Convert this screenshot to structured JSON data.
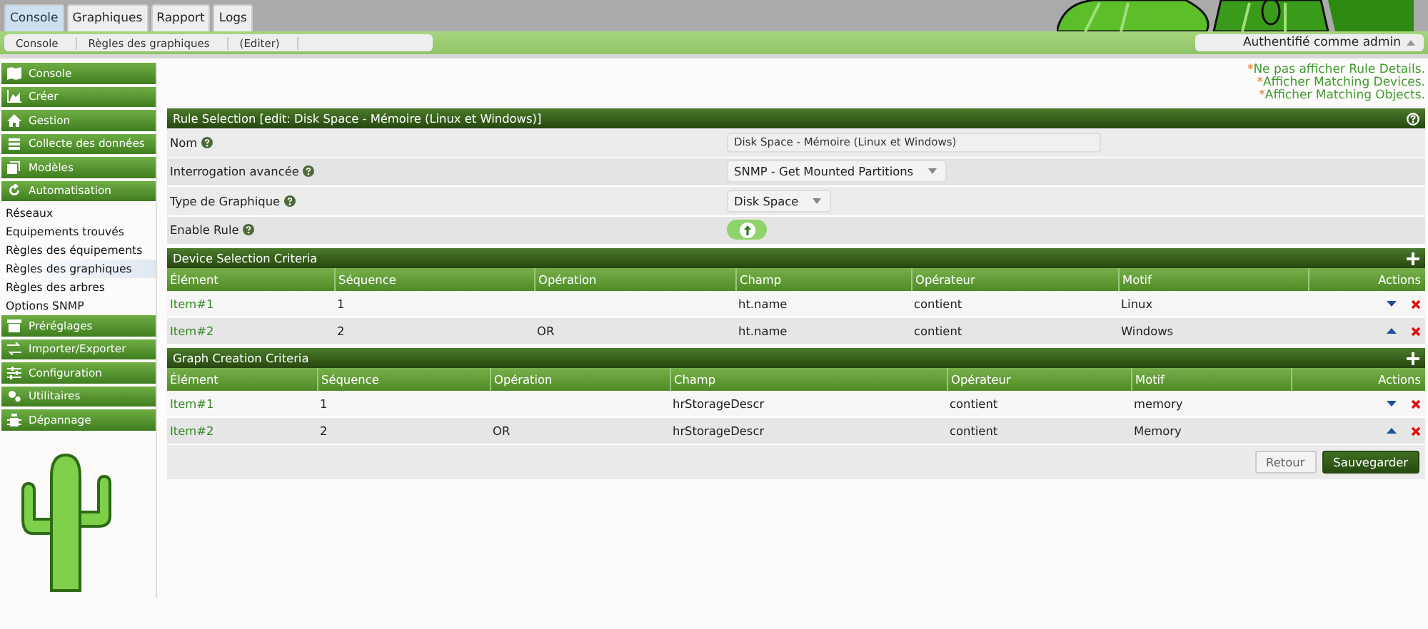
{
  "tabs": [
    {
      "label": "Console",
      "selected": true
    },
    {
      "label": "Graphiques",
      "selected": false
    },
    {
      "label": "Rapport",
      "selected": false
    },
    {
      "label": "Logs",
      "selected": false
    }
  ],
  "breadcrumb": [
    "Console",
    "Règles des graphiques",
    "(Editer)"
  ],
  "user_menu": {
    "label": "Authentifié comme admin"
  },
  "sidebar": {
    "items": [
      {
        "kind": "header",
        "label": "Console",
        "selected": false
      },
      {
        "kind": "header",
        "label": "Créer",
        "selected": false
      },
      {
        "kind": "header",
        "label": "Gestion",
        "selected": false
      },
      {
        "kind": "header",
        "label": "Collecte des données",
        "selected": false
      },
      {
        "kind": "header",
        "label": "Modèles",
        "selected": false
      },
      {
        "kind": "header",
        "label": "Automatisation",
        "selected": false
      },
      {
        "kind": "link",
        "label": "Réseaux",
        "selected": false
      },
      {
        "kind": "link",
        "label": "Equipements trouvés",
        "selected": false
      },
      {
        "kind": "link",
        "label": "Règles des équipements",
        "selected": false
      },
      {
        "kind": "link",
        "label": "Règles des graphiques",
        "selected": true
      },
      {
        "kind": "link",
        "label": "Règles des arbres",
        "selected": false
      },
      {
        "kind": "link",
        "label": "Options SNMP",
        "selected": false
      },
      {
        "kind": "header",
        "label": "Préréglages",
        "selected": false
      },
      {
        "kind": "header",
        "label": "Importer/Exporter",
        "selected": false
      },
      {
        "kind": "header",
        "label": "Configuration",
        "selected": false
      },
      {
        "kind": "header",
        "label": "Utilitaires",
        "selected": false
      },
      {
        "kind": "header",
        "label": "Dépannage",
        "selected": false
      }
    ]
  },
  "links": [
    {
      "marker": "*",
      "text": "Ne pas afficher Rule Details."
    },
    {
      "marker": "*",
      "text": "Afficher Matching Devices."
    },
    {
      "marker": "*",
      "text": "Afficher Matching Objects."
    }
  ],
  "rule_form": {
    "title": "Rule Selection [edit: Disk Space - Mémoire (Linux et Windows)]",
    "fields": [
      {
        "kind": "text",
        "label": "Nom",
        "value": "Disk Space - Mémoire (Linux et Windows)"
      },
      {
        "kind": "select",
        "label": "Interrogation avancée",
        "value": "SNMP - Get Mounted Partitions"
      },
      {
        "kind": "select",
        "label": "Type de Graphique",
        "value": "Disk Space"
      },
      {
        "kind": "toggle",
        "label": "Enable Rule",
        "on": true
      }
    ]
  },
  "tables": [
    {
      "title": "Device Selection Criteria",
      "columns": [
        "Élément",
        "Séquence",
        "Opération",
        "Champ",
        "Opérateur",
        "Motif",
        "Actions"
      ],
      "rows": [
        {
          "cells": [
            "Item#1",
            "1",
            "",
            "ht.name",
            "contient",
            "Linux"
          ],
          "move_up": false,
          "move_down": true
        },
        {
          "cells": [
            "Item#2",
            "2",
            "OR",
            "ht.name",
            "contient",
            "Windows"
          ],
          "move_up": true,
          "move_down": false
        }
      ]
    },
    {
      "title": "Graph Creation Criteria",
      "columns": [
        "Élément",
        "Séquence",
        "Opération",
        "Champ",
        "Opérateur",
        "Motif",
        "Actions"
      ],
      "rows": [
        {
          "cells": [
            "Item#1",
            "1",
            "",
            "hrStorageDescr",
            "contient",
            "memory"
          ],
          "move_up": false,
          "move_down": true
        },
        {
          "cells": [
            "Item#2",
            "2",
            "OR",
            "hrStorageDescr",
            "contient",
            "Memory"
          ],
          "move_up": true,
          "move_down": false
        }
      ]
    }
  ],
  "buttons": [
    "Retour",
    "Sauvegarder"
  ]
}
